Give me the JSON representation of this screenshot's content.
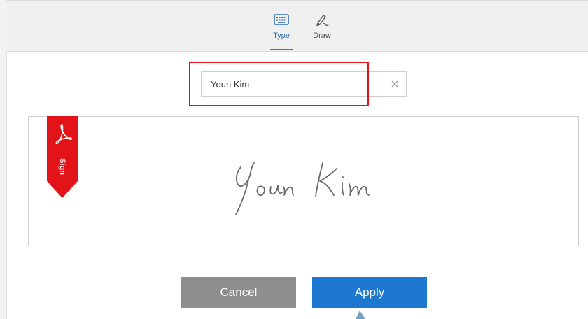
{
  "tabs": {
    "type_label": "Type",
    "draw_label": "Draw",
    "active": "type",
    "accent_color": "#2d6fb6"
  },
  "name_input": {
    "value": "Youn Kim"
  },
  "signature": {
    "preview_text": "Youn Kim",
    "flag_label": "Sign",
    "flag_color": "#e2141a",
    "baseline_color": "#4d8ed3"
  },
  "buttons": {
    "cancel_label": "Cancel",
    "apply_label": "Apply",
    "cancel_color": "#8e8e8e",
    "apply_color": "#1e78d2"
  }
}
